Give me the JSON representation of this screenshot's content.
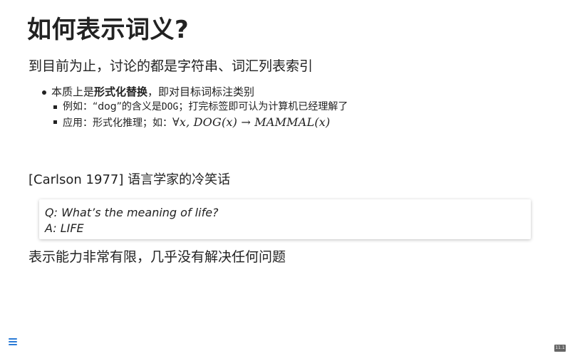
{
  "slide": {
    "title": "如何表示词义?",
    "subtitle": "到目前为止，讨论的都是字符串、词汇列表索引",
    "bullet_main": {
      "prefix": "本质上是",
      "bold": "形式化替换",
      "suffix": "，即对目标词标注类别"
    },
    "bullet_example": {
      "prefix": "例如：“dog”的含义是",
      "code": "DOG",
      "suffix": "；打完标签即可认为计算机已经理解了"
    },
    "bullet_application": {
      "prefix": "应用：形式化推理；如：",
      "math": "∀x, DOG(x) → MAMMAL(x)"
    },
    "quote_title": "[Carlson 1977] 语言学家的冷笑话",
    "quote_lines": [
      "Q: What’s the meaning of life?",
      "A: LIFE"
    ],
    "conclusion": "表示能力非常有限，几乎没有解决任何问题"
  },
  "controls": {
    "menu_icon": "menu-icon",
    "slide_number": "11.1"
  },
  "colors": {
    "text": "#222222",
    "accent": "#2b7bd6",
    "slide_number_bg": "#666666"
  }
}
